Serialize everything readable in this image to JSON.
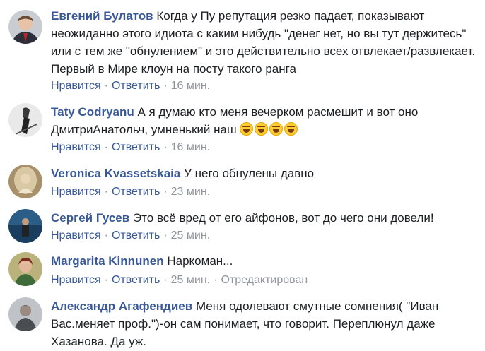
{
  "action_labels": {
    "like": "Нравится",
    "reply": "Ответить",
    "separator": "·"
  },
  "comments": [
    {
      "author": "Евгений Булатов",
      "text": "Когда у Пу репутация резко падает, показывают неожиданно этого идиота с каким нибудь \"денег нет, но вы тут держитесь\" или с тем же \"обнулением\" и это действительно всех отвлекает/развлекает. Первый в Мире клоун на посту такого ранга",
      "time": "16 мин.",
      "edited": ""
    },
    {
      "author": "Taty Codryanu",
      "text": "А я думаю кто меня вечерком расмешит и вот оно ДмитриАнатольч, умненький наш",
      "time": "16 мин.",
      "edited": "",
      "emoji": [
        "rofl-emoji",
        "rofl-emoji",
        "rofl-emoji",
        "rofl-emoji"
      ]
    },
    {
      "author": "Veronica Kvassetskaia",
      "text": "У него обнулены давно",
      "time": "23 мин.",
      "edited": ""
    },
    {
      "author": "Сергей Гусев",
      "text": "Это всё вред от его айфонов, вот до чего они довели!",
      "time": "25 мин.",
      "edited": ""
    },
    {
      "author": "Margarita Kinnunen",
      "text": "Наркоман...",
      "time": "25 мин.",
      "edited": "Отредактирован"
    },
    {
      "author": "Александр Агафендиев",
      "text": "Меня одолевают смутные сомнения( \"Иван Вас.меняет проф.\")-он сам понимает, что говорит. Переплюнул даже Хазанова. Да уж.",
      "time": "",
      "edited": ""
    }
  ]
}
